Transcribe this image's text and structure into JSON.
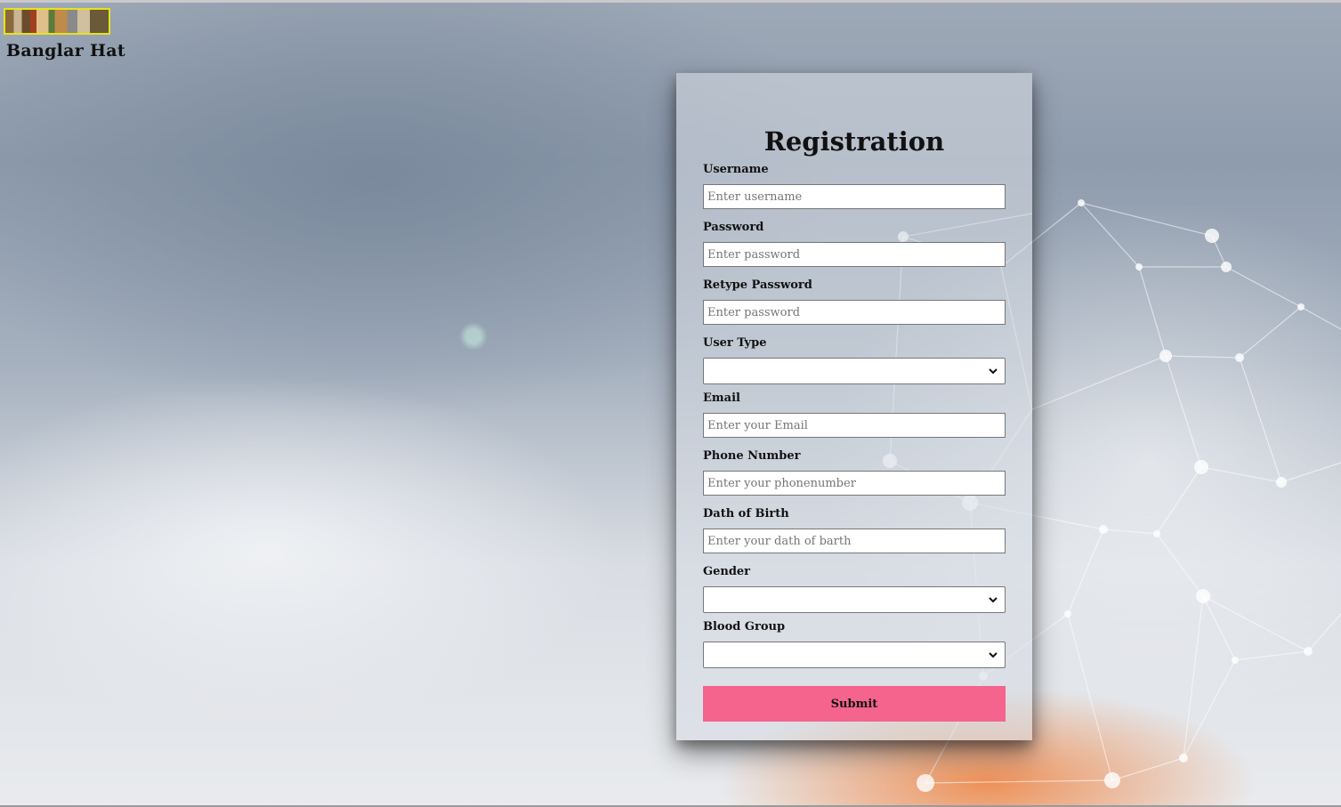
{
  "header": {
    "brand": "Banglar Hat"
  },
  "form": {
    "title": "Registration",
    "fields": {
      "username": {
        "label": "Username",
        "placeholder": "Enter username"
      },
      "password": {
        "label": "Password",
        "placeholder": "Enter password"
      },
      "retype_password": {
        "label": "Retype Password",
        "placeholder": "Enter password"
      },
      "user_type": {
        "label": "User Type",
        "value": ""
      },
      "email": {
        "label": "Email",
        "placeholder": "Enter your Email"
      },
      "phone": {
        "label": "Phone Number",
        "placeholder": "Enter your phonenumber"
      },
      "dob": {
        "label": "Dath of Birth",
        "placeholder": "Enter your dath of barth"
      },
      "gender": {
        "label": "Gender",
        "value": ""
      },
      "blood_group": {
        "label": "Blood Group",
        "value": ""
      }
    },
    "submit_label": "Submit"
  },
  "colors": {
    "submit_bg": "#f4648d",
    "logo_border": "#e8e21b"
  }
}
